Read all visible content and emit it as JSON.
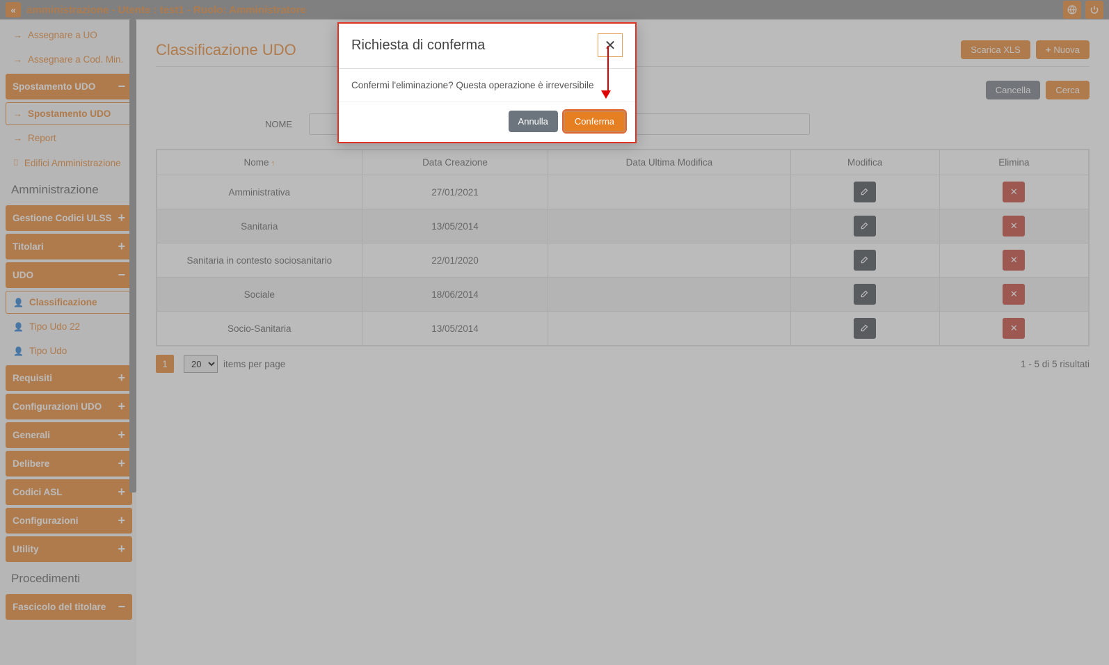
{
  "topbar": {
    "title": "amministrazione - Utente : test1 - Ruolo: Amministratore"
  },
  "sidebar": {
    "items_top": [
      {
        "label": "Assegnare a UO"
      },
      {
        "label": "Assegnare a Cod. Min."
      }
    ],
    "spostamento_header": "Spostamento UDO",
    "spostamento_item": "Spostamento UDO",
    "report": "Report",
    "edifici": "Edifici Amministrazione",
    "amministrazione_title": "Amministrazione",
    "gestione_codici": "Gestione Codici ULSS",
    "titolari": "Titolari",
    "udo_header": "UDO",
    "udo_items": [
      {
        "label": "Classificazione",
        "active": true
      },
      {
        "label": "Tipo Udo 22"
      },
      {
        "label": "Tipo Udo"
      }
    ],
    "requisiti": "Requisiti",
    "config_udo": "Configurazioni UDO",
    "generali": "Generali",
    "delibere": "Delibere",
    "codici_asl": "Codici ASL",
    "configurazioni": "Configurazioni",
    "utility": "Utility",
    "procedimenti_title": "Procedimenti",
    "fascicolo": "Fascicolo del titolare"
  },
  "main": {
    "title": "Classificazione UDO",
    "scarica": "Scarica XLS",
    "nuova": "Nuova",
    "cancella": "Cancella",
    "cerca": "Cerca",
    "nome_label": "NOME",
    "columns": [
      "Nome",
      "Data Creazione",
      "Data Ultima Modifica",
      "Modifica",
      "Elimina"
    ],
    "rows": [
      {
        "nome": "Amministrativa",
        "creazione": "27/01/2021",
        "modifica": ""
      },
      {
        "nome": "Sanitaria",
        "creazione": "13/05/2014",
        "modifica": ""
      },
      {
        "nome": "Sanitaria in contesto sociosanitario",
        "creazione": "22/01/2020",
        "modifica": ""
      },
      {
        "nome": "Sociale",
        "creazione": "18/06/2014",
        "modifica": ""
      },
      {
        "nome": "Socio-Sanitaria",
        "creazione": "13/05/2014",
        "modifica": ""
      }
    ],
    "page_current": "1",
    "page_size": "20",
    "items_per_page": "items per page",
    "results": "1 - 5 di 5 risultati"
  },
  "modal": {
    "title": "Richiesta di conferma",
    "body": "Confermi l'eliminazione? Questa operazione è irreversibile",
    "annulla": "Annulla",
    "conferma": "Conferma"
  }
}
